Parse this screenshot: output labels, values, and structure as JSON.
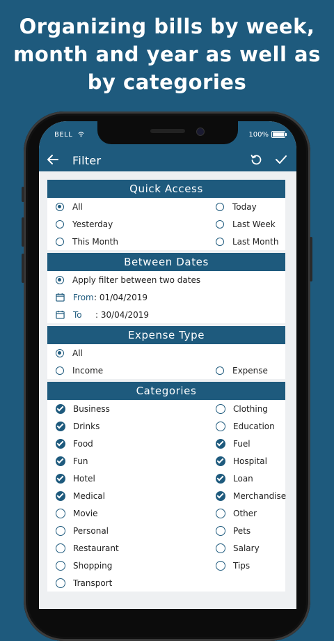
{
  "headline": {
    "line1": "Organizing bills by week,",
    "line2": "month and year as well as",
    "line3": "by categories"
  },
  "status": {
    "carrier": "BELL",
    "battery": "100%"
  },
  "appbar": {
    "title": "Filter"
  },
  "quick_access": {
    "title": "Quick Access",
    "options": [
      {
        "label": "All",
        "selected": true
      },
      {
        "label": "Today",
        "selected": false
      },
      {
        "label": "Yesterday",
        "selected": false
      },
      {
        "label": "Last Week",
        "selected": false
      },
      {
        "label": "This Month",
        "selected": false
      },
      {
        "label": "Last Month",
        "selected": false
      }
    ]
  },
  "between_dates": {
    "title": "Between Dates",
    "apply_label": "Apply filter between two dates",
    "from_label": "From",
    "from_value": ": 01/04/2019",
    "to_label": "To",
    "to_value": ": 30/04/2019"
  },
  "expense_type": {
    "title": "Expense Type",
    "options": [
      {
        "label": "All",
        "selected": true
      },
      {
        "label": "Income",
        "selected": false
      },
      {
        "label": "Expense",
        "selected": false
      }
    ]
  },
  "categories": {
    "title": "Categories",
    "items": [
      {
        "label": "Business",
        "checked": true
      },
      {
        "label": "Clothing",
        "checked": false
      },
      {
        "label": "Drinks",
        "checked": true
      },
      {
        "label": "Education",
        "checked": false
      },
      {
        "label": "Food",
        "checked": true
      },
      {
        "label": "Fuel",
        "checked": true
      },
      {
        "label": "Fun",
        "checked": true
      },
      {
        "label": "Hospital",
        "checked": true
      },
      {
        "label": "Hotel",
        "checked": true
      },
      {
        "label": "Loan",
        "checked": true
      },
      {
        "label": "Medical",
        "checked": true
      },
      {
        "label": "Merchandise",
        "checked": true
      },
      {
        "label": "Movie",
        "checked": false
      },
      {
        "label": "Other",
        "checked": false
      },
      {
        "label": "Personal",
        "checked": false
      },
      {
        "label": "Pets",
        "checked": false
      },
      {
        "label": "Restaurant",
        "checked": false
      },
      {
        "label": "Salary",
        "checked": false
      },
      {
        "label": "Shopping",
        "checked": false
      },
      {
        "label": "Tips",
        "checked": false
      },
      {
        "label": "Transport",
        "checked": false
      }
    ]
  },
  "colors": {
    "primary": "#1e5a7d",
    "background": "#eef0f2"
  }
}
